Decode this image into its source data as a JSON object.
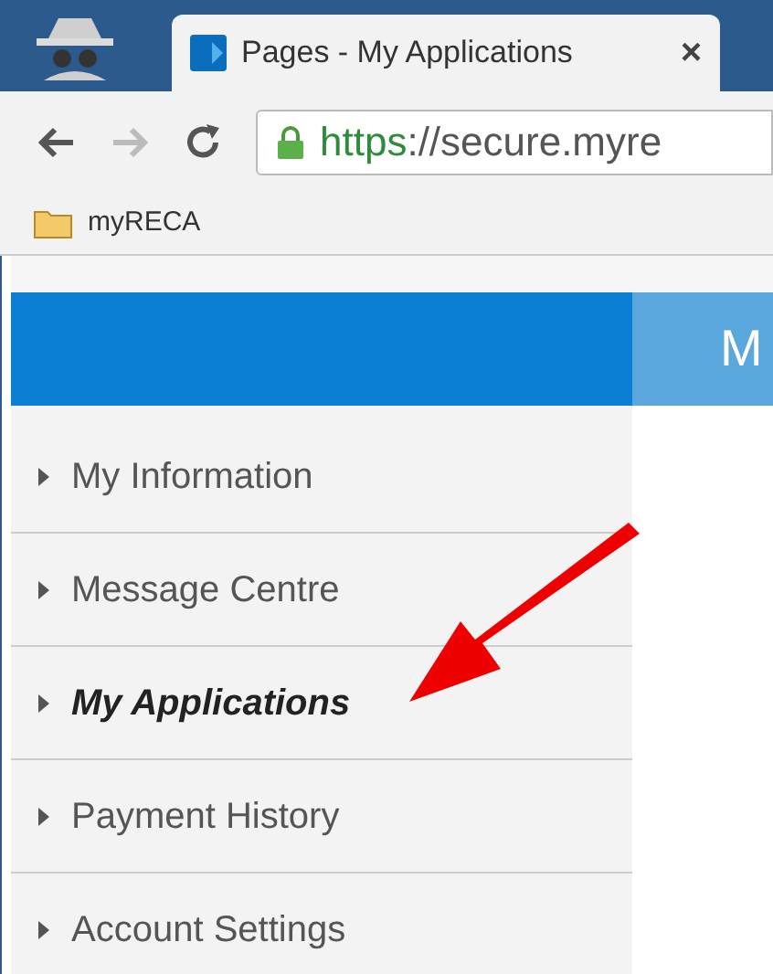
{
  "browser": {
    "tab": {
      "title": "Pages - My Applications",
      "close": "×"
    },
    "address": {
      "scheme": "https",
      "rest": "://secure.myre"
    },
    "bookmarks": [
      {
        "label": "myRECA"
      }
    ]
  },
  "page": {
    "header": {
      "title": "M"
    },
    "nav": [
      {
        "label": "My Information",
        "selected": false
      },
      {
        "label": "Message Centre",
        "selected": false
      },
      {
        "label": "My Applications",
        "selected": true
      },
      {
        "label": "Payment History",
        "selected": false
      },
      {
        "label": "Account Settings",
        "selected": false
      }
    ]
  }
}
